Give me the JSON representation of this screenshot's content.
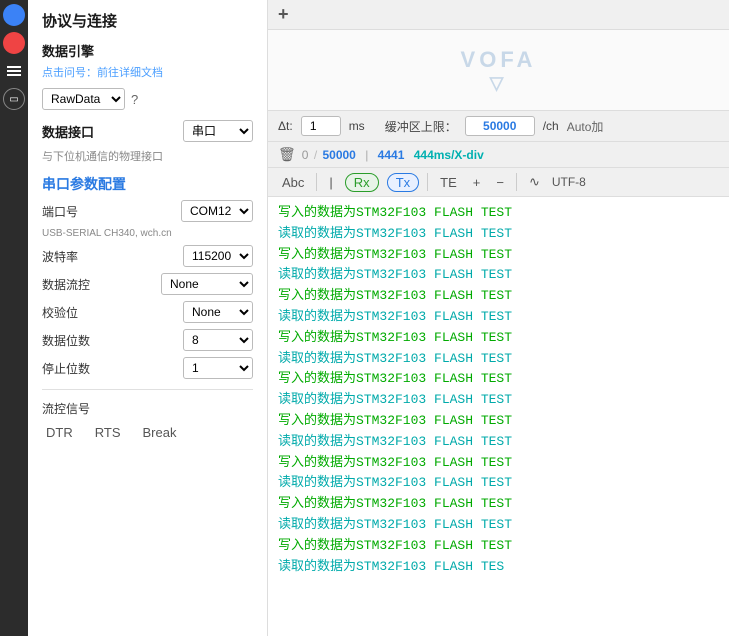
{
  "sidebar": {
    "icons": [
      {
        "name": "blue-circle-icon",
        "type": "circle-blue"
      },
      {
        "name": "red-record-icon",
        "type": "circle-red"
      },
      {
        "name": "menu-icon",
        "type": "menu"
      },
      {
        "name": "tab-icon",
        "type": "tab"
      }
    ]
  },
  "settings": {
    "title": "协议与连接",
    "data_engine": {
      "label": "数据引擎",
      "sub_link": "点击问号：前往详细文档",
      "mode": "RawData",
      "question": "?"
    },
    "data_interface": {
      "label": "数据接口",
      "value": "串口",
      "desc": "与下位机通信的物理接口"
    },
    "serial_config": {
      "title": "串口参数配置",
      "port": {
        "label": "端口号",
        "value": "COM12",
        "usb_desc": "USB-SERIAL CH340, wch.cn"
      },
      "baud": {
        "label": "波特率",
        "value": "115200"
      },
      "flow_control": {
        "label": "数据流控",
        "value": "None"
      },
      "parity": {
        "label": "校验位",
        "value": "None"
      },
      "data_bits": {
        "label": "数据位数",
        "value": "8"
      },
      "stop_bits": {
        "label": "停止位数",
        "value": "1"
      },
      "flow_signal": {
        "label": "流控信号",
        "buttons": [
          "DTR",
          "RTS",
          "Break"
        ]
      }
    }
  },
  "main": {
    "top_bar": {
      "add_label": "+"
    },
    "vofa": {
      "text": "VOFA"
    },
    "controls": {
      "delta_t_label": "Δt:",
      "delta_t_value": "1",
      "ms_label": "ms",
      "buffer_label": "缓冲区上限：",
      "buffer_value": "50000",
      "per_ch_label": "/ch",
      "auto_label": "Auto加"
    },
    "data_bar": {
      "count_current": "0",
      "separator": "/",
      "count_total": "50000",
      "pipe": "|",
      "count_actual": "4441",
      "rate": "444ms/X-div"
    },
    "text_toolbar": {
      "abc_label": "Abc",
      "pipe_label": "|",
      "rx_label": "Rx",
      "tx_label": "Tx",
      "align_label": "TE",
      "plus_label": "+",
      "minus_label": "−",
      "wave_label": "∿",
      "encoding_label": "UTF-8"
    },
    "data_lines": [
      {
        "type": "write",
        "text": "写入的数据为STM32F103 FLASH TEST"
      },
      {
        "type": "read",
        "text": "读取的数据为STM32F103 FLASH TEST"
      },
      {
        "type": "write",
        "text": "写入的数据为STM32F103 FLASH TEST"
      },
      {
        "type": "read",
        "text": "读取的数据为STM32F103 FLASH TEST"
      },
      {
        "type": "write",
        "text": "写入的数据为STM32F103 FLASH TEST"
      },
      {
        "type": "read",
        "text": "读取的数据为STM32F103 FLASH TEST"
      },
      {
        "type": "write",
        "text": "写入的数据为STM32F103 FLASH TEST"
      },
      {
        "type": "read",
        "text": "读取的数据为STM32F103 FLASH TEST"
      },
      {
        "type": "write",
        "text": "写入的数据为STM32F103 FLASH TEST"
      },
      {
        "type": "read",
        "text": "读取的数据为STM32F103 FLASH TEST"
      },
      {
        "type": "write",
        "text": "写入的数据为STM32F103 FLASH TEST"
      },
      {
        "type": "read",
        "text": "读取的数据为STM32F103 FLASH TEST"
      },
      {
        "type": "write",
        "text": "写入的数据为STM32F103 FLASH TEST"
      },
      {
        "type": "read",
        "text": "读取的数据为STM32F103 FLASH TEST"
      },
      {
        "type": "write",
        "text": "写入的数据为STM32F103 FLASH TEST"
      },
      {
        "type": "read",
        "text": "读取的数据为STM32F103 FLASH TEST"
      },
      {
        "type": "write",
        "text": "写入的数据为STM32F103 FLASH TEST"
      },
      {
        "type": "read",
        "text": "读取的数据为STM32F103 FLASH TES"
      }
    ]
  }
}
